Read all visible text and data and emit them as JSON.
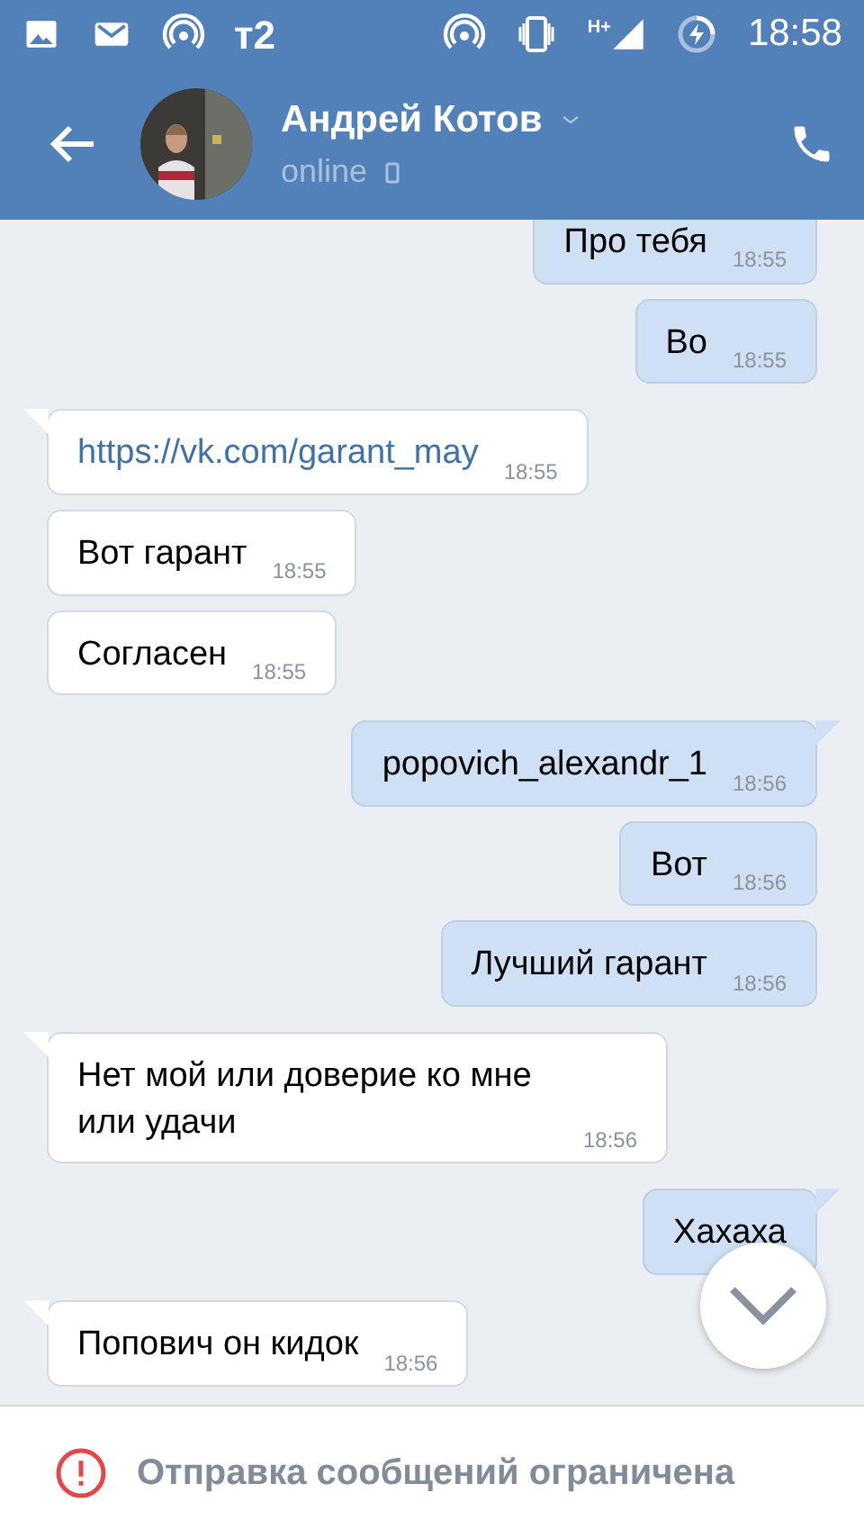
{
  "status_bar": {
    "carrier": "т2",
    "network": "H+",
    "time": "18:58"
  },
  "header": {
    "name": "Андрей Котов",
    "presence": "online"
  },
  "messages": [
    {
      "kind": "text",
      "out": true,
      "tail": false,
      "text": "Про тебя",
      "time": "18:55"
    },
    {
      "kind": "text",
      "out": true,
      "tail": false,
      "text": "Во",
      "time": "18:55"
    },
    {
      "kind": "link",
      "out": false,
      "tail": true,
      "text": "https://vk.com/garant_may",
      "time": "18:55"
    },
    {
      "kind": "text",
      "out": false,
      "tail": false,
      "text": "Вот гарант",
      "time": "18:55"
    },
    {
      "kind": "text",
      "out": false,
      "tail": false,
      "text": "Согласен",
      "time": "18:55"
    },
    {
      "kind": "text",
      "out": true,
      "tail": true,
      "text": "popovich_alexandr_1",
      "time": "18:56"
    },
    {
      "kind": "text",
      "out": true,
      "tail": false,
      "text": "Вот",
      "time": "18:56"
    },
    {
      "kind": "text",
      "out": true,
      "tail": false,
      "text": "Лучший гарант",
      "time": "18:56"
    },
    {
      "kind": "text",
      "out": false,
      "tail": true,
      "text": "Нет мой или доверие ко мне или удачи",
      "time": "18:56"
    },
    {
      "kind": "text",
      "out": true,
      "tail": true,
      "text": "Хахаха"
    },
    {
      "kind": "text",
      "out": false,
      "tail": true,
      "text": "Попович он кидок",
      "time": "18:56"
    }
  ],
  "footer": {
    "notice": "Отправка сообщений ограничена"
  }
}
